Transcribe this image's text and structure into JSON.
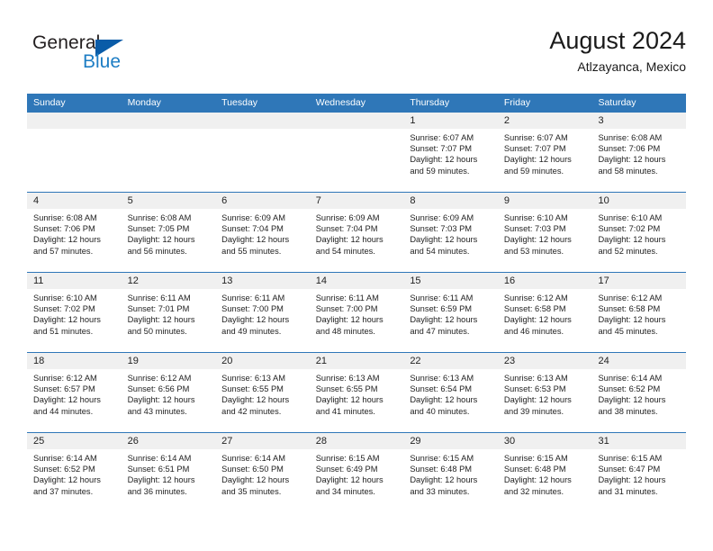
{
  "brand": {
    "name_top": "General",
    "name_bottom": "Blue",
    "mark": "triangle-logo",
    "accent_color": "#0a5ca8",
    "blue_text_color": "#1d7dc4"
  },
  "header": {
    "title": "August 2024",
    "subtitle": "Atlzayanca, Mexico"
  },
  "calendar": {
    "header_bg": "#2f77b8",
    "daynum_bg": "#f0f0f0",
    "weekdays": [
      "Sunday",
      "Monday",
      "Tuesday",
      "Wednesday",
      "Thursday",
      "Friday",
      "Saturday"
    ],
    "weeks": [
      [
        {
          "day": "",
          "sunrise": "",
          "sunset": "",
          "daylight": "",
          "daylight2": ""
        },
        {
          "day": "",
          "sunrise": "",
          "sunset": "",
          "daylight": "",
          "daylight2": ""
        },
        {
          "day": "",
          "sunrise": "",
          "sunset": "",
          "daylight": "",
          "daylight2": ""
        },
        {
          "day": "",
          "sunrise": "",
          "sunset": "",
          "daylight": "",
          "daylight2": ""
        },
        {
          "day": "1",
          "sunrise": "Sunrise: 6:07 AM",
          "sunset": "Sunset: 7:07 PM",
          "daylight": "Daylight: 12 hours",
          "daylight2": "and 59 minutes."
        },
        {
          "day": "2",
          "sunrise": "Sunrise: 6:07 AM",
          "sunset": "Sunset: 7:07 PM",
          "daylight": "Daylight: 12 hours",
          "daylight2": "and 59 minutes."
        },
        {
          "day": "3",
          "sunrise": "Sunrise: 6:08 AM",
          "sunset": "Sunset: 7:06 PM",
          "daylight": "Daylight: 12 hours",
          "daylight2": "and 58 minutes."
        }
      ],
      [
        {
          "day": "4",
          "sunrise": "Sunrise: 6:08 AM",
          "sunset": "Sunset: 7:06 PM",
          "daylight": "Daylight: 12 hours",
          "daylight2": "and 57 minutes."
        },
        {
          "day": "5",
          "sunrise": "Sunrise: 6:08 AM",
          "sunset": "Sunset: 7:05 PM",
          "daylight": "Daylight: 12 hours",
          "daylight2": "and 56 minutes."
        },
        {
          "day": "6",
          "sunrise": "Sunrise: 6:09 AM",
          "sunset": "Sunset: 7:04 PM",
          "daylight": "Daylight: 12 hours",
          "daylight2": "and 55 minutes."
        },
        {
          "day": "7",
          "sunrise": "Sunrise: 6:09 AM",
          "sunset": "Sunset: 7:04 PM",
          "daylight": "Daylight: 12 hours",
          "daylight2": "and 54 minutes."
        },
        {
          "day": "8",
          "sunrise": "Sunrise: 6:09 AM",
          "sunset": "Sunset: 7:03 PM",
          "daylight": "Daylight: 12 hours",
          "daylight2": "and 54 minutes."
        },
        {
          "day": "9",
          "sunrise": "Sunrise: 6:10 AM",
          "sunset": "Sunset: 7:03 PM",
          "daylight": "Daylight: 12 hours",
          "daylight2": "and 53 minutes."
        },
        {
          "day": "10",
          "sunrise": "Sunrise: 6:10 AM",
          "sunset": "Sunset: 7:02 PM",
          "daylight": "Daylight: 12 hours",
          "daylight2": "and 52 minutes."
        }
      ],
      [
        {
          "day": "11",
          "sunrise": "Sunrise: 6:10 AM",
          "sunset": "Sunset: 7:02 PM",
          "daylight": "Daylight: 12 hours",
          "daylight2": "and 51 minutes."
        },
        {
          "day": "12",
          "sunrise": "Sunrise: 6:11 AM",
          "sunset": "Sunset: 7:01 PM",
          "daylight": "Daylight: 12 hours",
          "daylight2": "and 50 minutes."
        },
        {
          "day": "13",
          "sunrise": "Sunrise: 6:11 AM",
          "sunset": "Sunset: 7:00 PM",
          "daylight": "Daylight: 12 hours",
          "daylight2": "and 49 minutes."
        },
        {
          "day": "14",
          "sunrise": "Sunrise: 6:11 AM",
          "sunset": "Sunset: 7:00 PM",
          "daylight": "Daylight: 12 hours",
          "daylight2": "and 48 minutes."
        },
        {
          "day": "15",
          "sunrise": "Sunrise: 6:11 AM",
          "sunset": "Sunset: 6:59 PM",
          "daylight": "Daylight: 12 hours",
          "daylight2": "and 47 minutes."
        },
        {
          "day": "16",
          "sunrise": "Sunrise: 6:12 AM",
          "sunset": "Sunset: 6:58 PM",
          "daylight": "Daylight: 12 hours",
          "daylight2": "and 46 minutes."
        },
        {
          "day": "17",
          "sunrise": "Sunrise: 6:12 AM",
          "sunset": "Sunset: 6:58 PM",
          "daylight": "Daylight: 12 hours",
          "daylight2": "and 45 minutes."
        }
      ],
      [
        {
          "day": "18",
          "sunrise": "Sunrise: 6:12 AM",
          "sunset": "Sunset: 6:57 PM",
          "daylight": "Daylight: 12 hours",
          "daylight2": "and 44 minutes."
        },
        {
          "day": "19",
          "sunrise": "Sunrise: 6:12 AM",
          "sunset": "Sunset: 6:56 PM",
          "daylight": "Daylight: 12 hours",
          "daylight2": "and 43 minutes."
        },
        {
          "day": "20",
          "sunrise": "Sunrise: 6:13 AM",
          "sunset": "Sunset: 6:55 PM",
          "daylight": "Daylight: 12 hours",
          "daylight2": "and 42 minutes."
        },
        {
          "day": "21",
          "sunrise": "Sunrise: 6:13 AM",
          "sunset": "Sunset: 6:55 PM",
          "daylight": "Daylight: 12 hours",
          "daylight2": "and 41 minutes."
        },
        {
          "day": "22",
          "sunrise": "Sunrise: 6:13 AM",
          "sunset": "Sunset: 6:54 PM",
          "daylight": "Daylight: 12 hours",
          "daylight2": "and 40 minutes."
        },
        {
          "day": "23",
          "sunrise": "Sunrise: 6:13 AM",
          "sunset": "Sunset: 6:53 PM",
          "daylight": "Daylight: 12 hours",
          "daylight2": "and 39 minutes."
        },
        {
          "day": "24",
          "sunrise": "Sunrise: 6:14 AM",
          "sunset": "Sunset: 6:52 PM",
          "daylight": "Daylight: 12 hours",
          "daylight2": "and 38 minutes."
        }
      ],
      [
        {
          "day": "25",
          "sunrise": "Sunrise: 6:14 AM",
          "sunset": "Sunset: 6:52 PM",
          "daylight": "Daylight: 12 hours",
          "daylight2": "and 37 minutes."
        },
        {
          "day": "26",
          "sunrise": "Sunrise: 6:14 AM",
          "sunset": "Sunset: 6:51 PM",
          "daylight": "Daylight: 12 hours",
          "daylight2": "and 36 minutes."
        },
        {
          "day": "27",
          "sunrise": "Sunrise: 6:14 AM",
          "sunset": "Sunset: 6:50 PM",
          "daylight": "Daylight: 12 hours",
          "daylight2": "and 35 minutes."
        },
        {
          "day": "28",
          "sunrise": "Sunrise: 6:15 AM",
          "sunset": "Sunset: 6:49 PM",
          "daylight": "Daylight: 12 hours",
          "daylight2": "and 34 minutes."
        },
        {
          "day": "29",
          "sunrise": "Sunrise: 6:15 AM",
          "sunset": "Sunset: 6:48 PM",
          "daylight": "Daylight: 12 hours",
          "daylight2": "and 33 minutes."
        },
        {
          "day": "30",
          "sunrise": "Sunrise: 6:15 AM",
          "sunset": "Sunset: 6:48 PM",
          "daylight": "Daylight: 12 hours",
          "daylight2": "and 32 minutes."
        },
        {
          "day": "31",
          "sunrise": "Sunrise: 6:15 AM",
          "sunset": "Sunset: 6:47 PM",
          "daylight": "Daylight: 12 hours",
          "daylight2": "and 31 minutes."
        }
      ]
    ]
  }
}
